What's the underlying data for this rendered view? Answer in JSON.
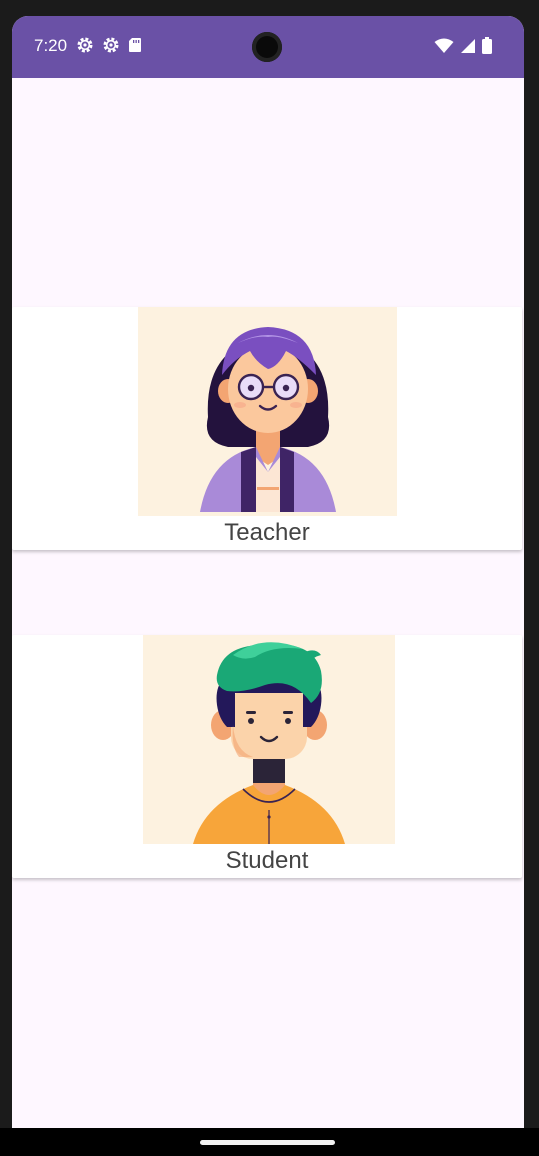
{
  "status_bar": {
    "time": "7:20",
    "left_icons": [
      "settings-gear-icon",
      "settings-gear-icon",
      "sd-card-icon"
    ],
    "right_icons": [
      "wifi-icon",
      "cell-signal-icon",
      "battery-icon"
    ],
    "color": "#6a51a6"
  },
  "cards": [
    {
      "label": "Teacher",
      "image": "teacher-avatar"
    },
    {
      "label": "Student",
      "image": "student-avatar"
    }
  ],
  "colors": {
    "background": "#fef7ff",
    "card": "#ffffff",
    "avatar_background": "#fdf2e0",
    "label_text": "#444444"
  }
}
